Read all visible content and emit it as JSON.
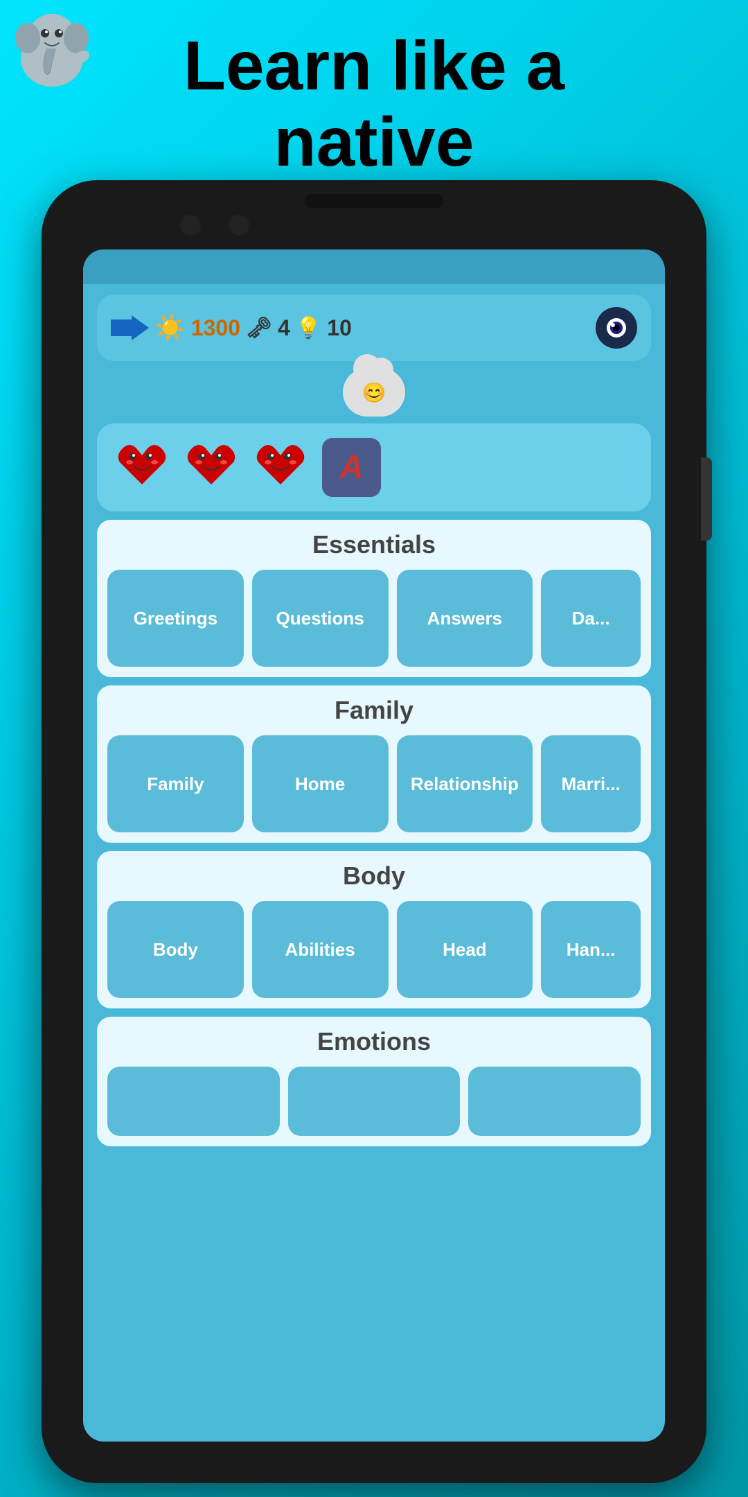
{
  "header": {
    "title_line1": "Learn like a",
    "title_line2": "native"
  },
  "stats": {
    "sun_value": "1300",
    "key_value": "4",
    "bulb_value": "10"
  },
  "hearts": {
    "count": 3,
    "has_letter_box": true,
    "letter": "A"
  },
  "sections": [
    {
      "id": "essentials",
      "title": "Essentials",
      "items": [
        "Greetings",
        "Questions",
        "Answers",
        "Da..."
      ]
    },
    {
      "id": "family",
      "title": "Family",
      "items": [
        "Family",
        "Home",
        "Relationship",
        "Marri..."
      ]
    },
    {
      "id": "body",
      "title": "Body",
      "items": [
        "Body",
        "Abilities",
        "Head",
        "Han..."
      ]
    },
    {
      "id": "emotions",
      "title": "Emotions",
      "items": [
        "",
        "",
        ""
      ]
    }
  ],
  "icons": {
    "back_arrows": "back-arrows-icon",
    "sun": "☀",
    "key": "🗝",
    "bulb": "💡",
    "eye": "👁",
    "heart": "❤",
    "cloud": "cloud-mascot-icon",
    "letter_a": "A"
  },
  "colors": {
    "background": "#00e5ff",
    "screen_bg": "#4ab8d8",
    "stats_bar": "#5bc4e0",
    "hearts_bar": "#6dd0ea",
    "section_bg": "#e8f8ff",
    "item_bg": "#5abcd8",
    "letter_box_bg": "#4a5a8a"
  }
}
